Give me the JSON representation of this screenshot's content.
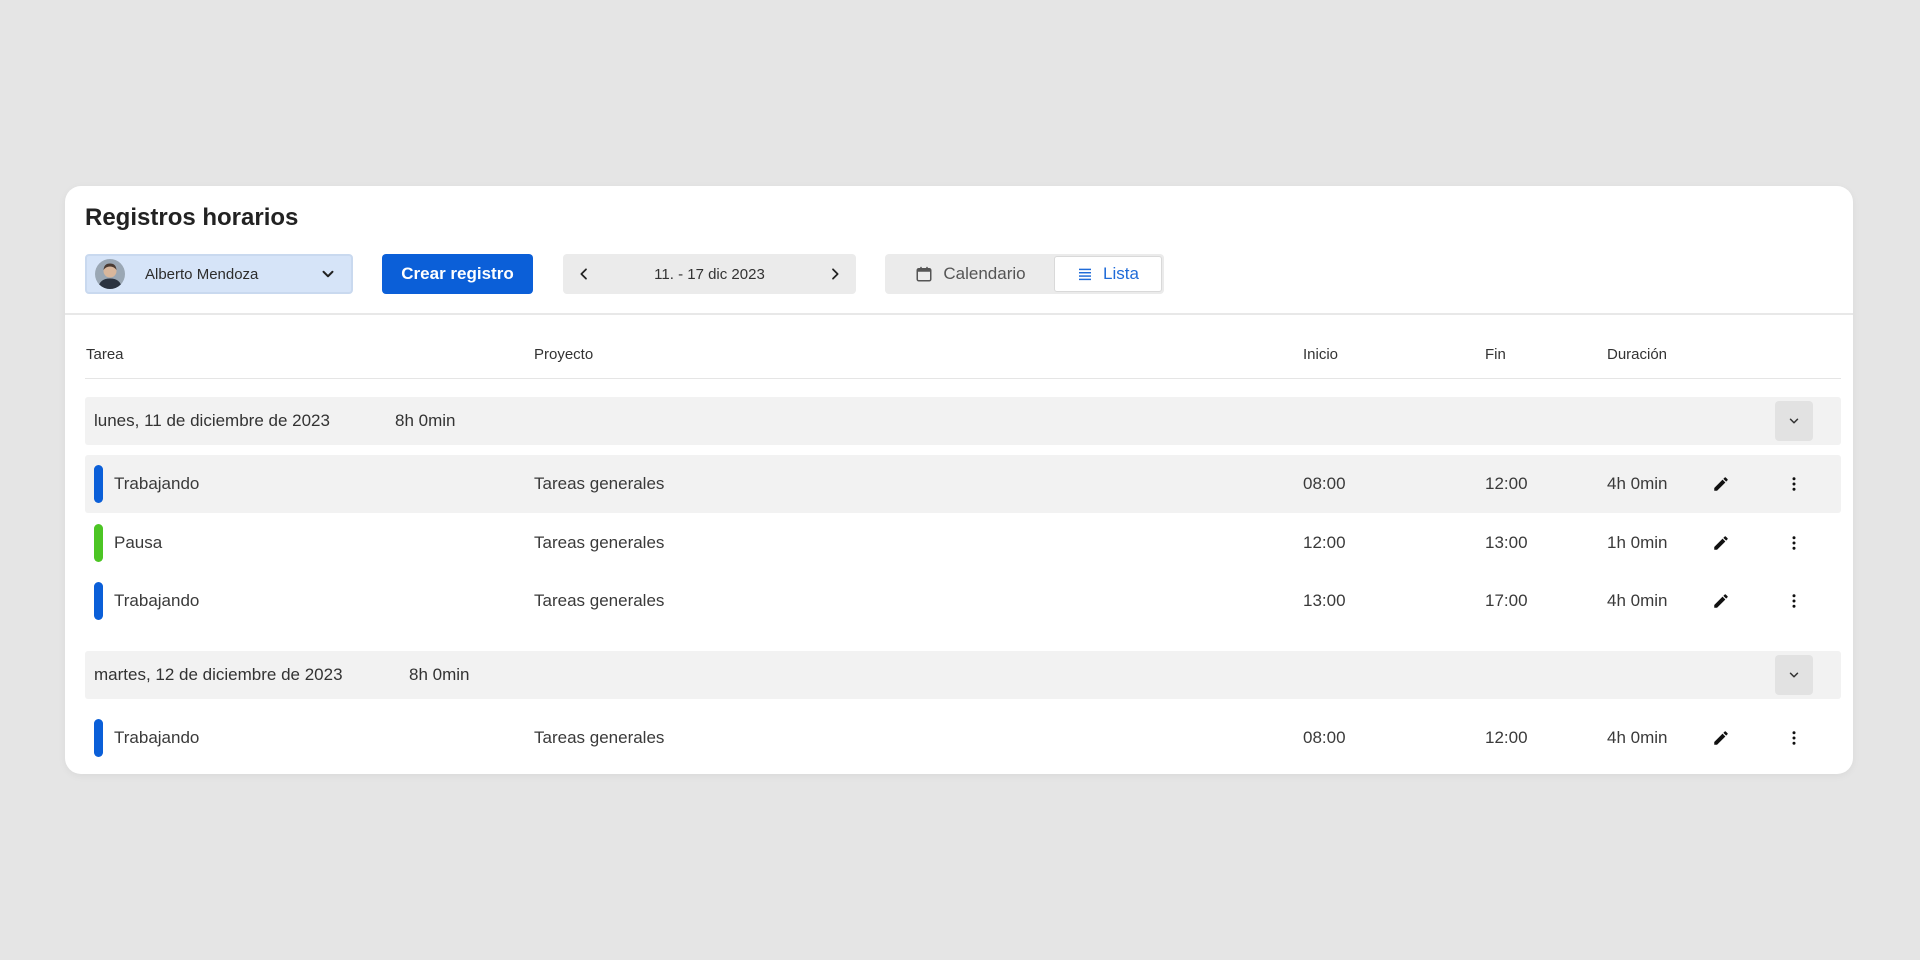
{
  "page": {
    "title": "Registros horarios"
  },
  "toolbar": {
    "user_name": "Alberto Mendoza",
    "create_label": "Crear registro",
    "week_range": "11. - 17 dic 2023",
    "views": {
      "calendar_label": "Calendario",
      "list_label": "Lista",
      "selected": "Lista"
    }
  },
  "table": {
    "headers": {
      "task": "Tarea",
      "project": "Proyecto",
      "start": "Inicio",
      "end": "Fin",
      "duration": "Duración"
    },
    "days": [
      {
        "date": "lunes, 11 de diciembre de 2023",
        "total": "8h 0min",
        "entries": [
          {
            "task": "Trabajando",
            "project": "Tareas generales",
            "start": "08:00",
            "end": "12:00",
            "duration": "4h 0min",
            "color": "#0b5fd8"
          },
          {
            "task": "Pausa",
            "project": "Tareas generales",
            "start": "12:00",
            "end": "13:00",
            "duration": "1h 0min",
            "color": "#4cc524"
          },
          {
            "task": "Trabajando",
            "project": "Tareas generales",
            "start": "13:00",
            "end": "17:00",
            "duration": "4h 0min",
            "color": "#0b5fd8"
          }
        ]
      },
      {
        "date": "martes, 12 de diciembre de 2023",
        "total": "8h 0min",
        "entries": [
          {
            "task": "Trabajando",
            "project": "Tareas generales",
            "start": "08:00",
            "end": "12:00",
            "duration": "4h 0min",
            "color": "#0b5fd8"
          }
        ]
      }
    ]
  },
  "colors": {
    "primary": "#0b5fd8",
    "work": "#0b5fd8",
    "pause": "#4cc524",
    "background": "#e5e5e5"
  },
  "icons": {
    "user_dropdown": "chevron-down-icon",
    "prev_week": "chevron-left-icon",
    "next_week": "chevron-right-icon",
    "calendar": "calendar-icon",
    "list": "list-icon",
    "collapse": "chevron-down-icon",
    "edit": "pencil-icon",
    "more": "more-vertical-icon"
  }
}
